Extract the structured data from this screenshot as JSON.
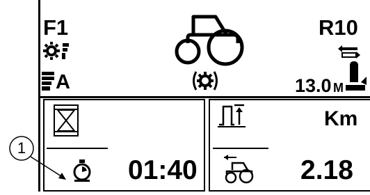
{
  "top_bar": {
    "gear_indicator": "F1",
    "range_indicator": "R10",
    "mode_letter": "A",
    "hitch_height": "13.0",
    "hitch_unit": "M",
    "icons": [
      "gear-lever-icon",
      "tractor-icon",
      "reverse-arrows-icon",
      "pto-icon",
      "hitch-icon",
      "auto-bars-icon"
    ]
  },
  "panel_left": {
    "value": "01:40",
    "icons": [
      "hourglass-icon",
      "engine-hours-icon"
    ]
  },
  "panel_right": {
    "unit": "Km",
    "value": "2.18",
    "icons": [
      "distance-icon",
      "tractor-small-icon"
    ]
  },
  "callout": {
    "number": "1"
  }
}
